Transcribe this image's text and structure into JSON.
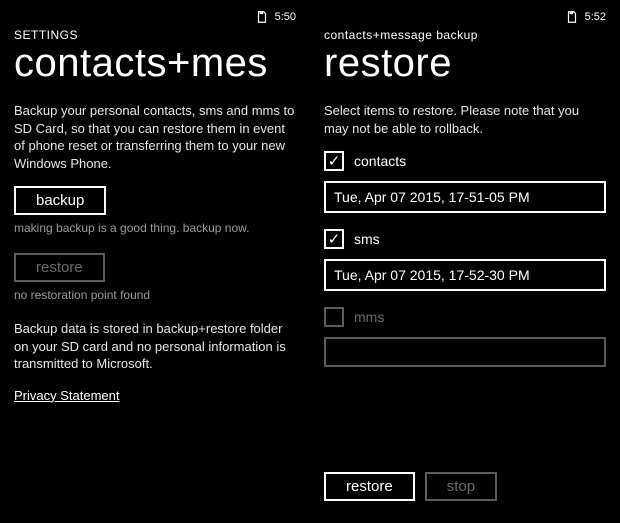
{
  "left": {
    "status": {
      "time": "5:50"
    },
    "breadcrumb": "SETTINGS",
    "title": "contacts+mes",
    "intro": "Backup your personal contacts, sms and mms to SD Card, so that you can restore them in event of phone reset or transferring them to your new Windows Phone.",
    "backup_button": "backup",
    "backup_hint": "making backup is a good thing. backup now.",
    "restore_button": "restore",
    "restore_hint": "no restoration point found",
    "footer": "Backup data is stored in backup+restore folder on your SD card and no personal information is transmitted to Microsoft.",
    "privacy_link": "Privacy Statement"
  },
  "right": {
    "status": {
      "time": "5:52"
    },
    "breadcrumb": "contacts+message backup",
    "title": "restore",
    "intro": "Select items to restore. Please note that you may not be able to rollback.",
    "items": {
      "contacts": {
        "label": "contacts",
        "checked": true,
        "value": "Tue, Apr 07 2015, 17-51-05 PM"
      },
      "sms": {
        "label": "sms",
        "checked": true,
        "value": "Tue, Apr 07 2015, 17-52-30 PM"
      },
      "mms": {
        "label": "mms",
        "checked": false,
        "value": ""
      }
    },
    "restore_button": "restore",
    "stop_button": "stop"
  }
}
